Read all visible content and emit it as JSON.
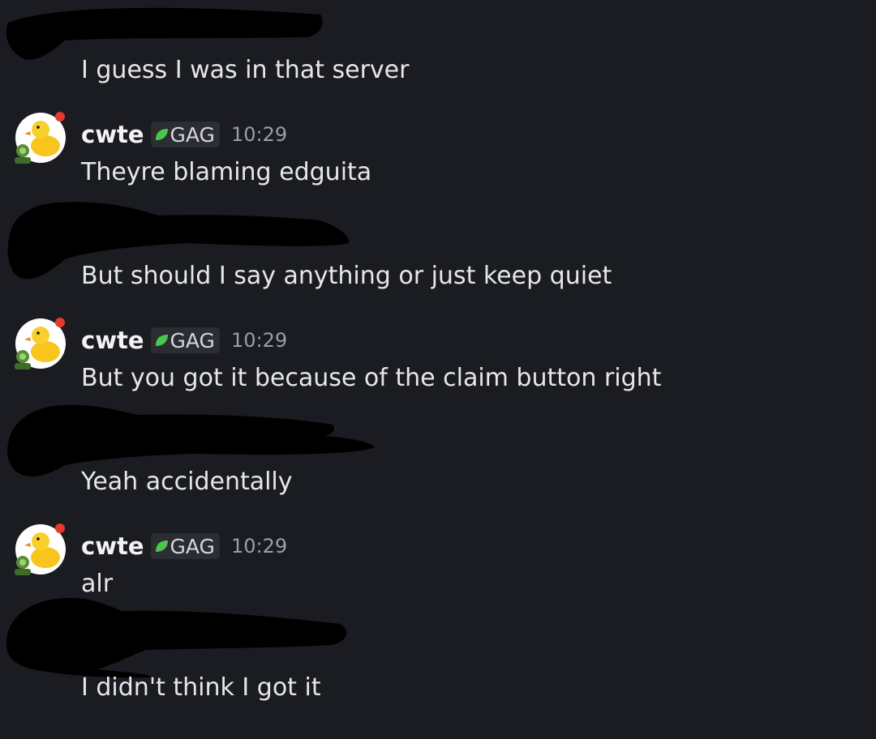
{
  "messages": [
    {
      "author_redacted": true,
      "text": "I guess I was in that server"
    },
    {
      "author": "cwte",
      "tag": "GAG",
      "time": "10:29",
      "text": "Theyre blaming edguita"
    },
    {
      "author_redacted": true,
      "text": "But should I say anything or just keep quiet"
    },
    {
      "author": "cwte",
      "tag": "GAG",
      "time": "10:29",
      "text": "But you got it because of the claim button right"
    },
    {
      "author_redacted": true,
      "text": "Yeah accidentally"
    },
    {
      "author": "cwte",
      "tag": "GAG",
      "time": "10:29",
      "text": "alr"
    },
    {
      "author_redacted": true,
      "text": "I didn't think I got it"
    }
  ],
  "colors": {
    "background": "#1b1c21",
    "message_text": "#e6e7ea",
    "username": "#f2f3f5",
    "timestamp": "#9b9ea6",
    "tag_background": "#2c2d33",
    "tag_leaf": "#4cc64c",
    "redaction": "#000000"
  },
  "icons": {
    "avatar": "duck-avatar-icon",
    "tag": "leaf-icon"
  }
}
